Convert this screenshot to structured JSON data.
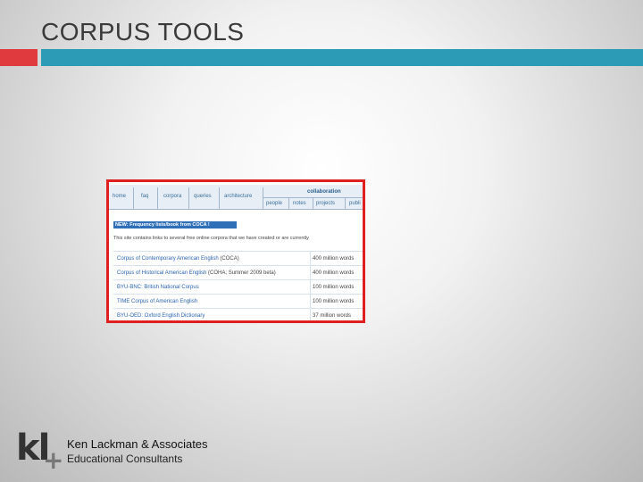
{
  "slide": {
    "title": "CORPUS TOOLS"
  },
  "colors": {
    "accent_red": "#e03a3e",
    "accent_teal": "#2c9cb6",
    "highlight_border": "#e02020",
    "link_blue": "#2b63b0"
  },
  "screenshot": {
    "nav": [
      "home",
      "faq",
      "corpora",
      "queries",
      "architecture"
    ],
    "collab": {
      "title": "collaboration",
      "items": [
        "people",
        "notes",
        "projects",
        "publi"
      ]
    },
    "news": "NEW: Frequency lists/book from COCA !",
    "intro": "This site contains links to several free online corpora that we have created or are currently",
    "corpora": [
      {
        "name": "Corpus of Contemporary American English",
        "suffix": " (COCA)",
        "words": "400 million words"
      },
      {
        "name": "Corpus of Historical American English",
        "suffix": " (COHA; Summer 2009 beta)",
        "words": "400 million words"
      },
      {
        "name": "BYU-BNC: British National Corpus",
        "suffix": "",
        "words": "100 million words"
      },
      {
        "name": "TIME Corpus of American English",
        "suffix": "",
        "words": "100 million words"
      },
      {
        "name": "BYU-OED: Oxford English Dictionary",
        "suffix": "",
        "words": "37 million words"
      }
    ]
  },
  "footer": {
    "logo_text": "kl",
    "logo_plus": "+",
    "company": "Ken Lackman & Associates",
    "tagline": "Educational Consultants"
  }
}
